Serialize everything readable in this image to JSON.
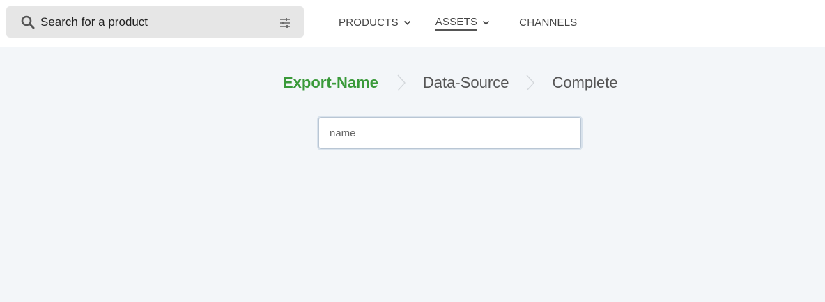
{
  "search": {
    "placeholder_text": "Search for a product",
    "icon": "search-icon",
    "filter_icon": "filter-sliders-icon"
  },
  "nav": {
    "items": [
      {
        "label": "PRODUCTS",
        "has_dropdown": true,
        "active": false
      },
      {
        "label": "ASSETS",
        "has_dropdown": true,
        "active": true
      },
      {
        "label": "CHANNELS",
        "has_dropdown": false,
        "active": false
      }
    ]
  },
  "stepper": {
    "steps": [
      {
        "label": "Export-Name",
        "state": "active"
      },
      {
        "label": "Data-Source",
        "state": "pending"
      },
      {
        "label": "Complete",
        "state": "pending"
      }
    ]
  },
  "form": {
    "name_placeholder": "name",
    "name_value": ""
  },
  "colors": {
    "active_step": "#3a9a3a",
    "page_background": "#f3f6f9",
    "search_background": "#e6e6e6"
  }
}
